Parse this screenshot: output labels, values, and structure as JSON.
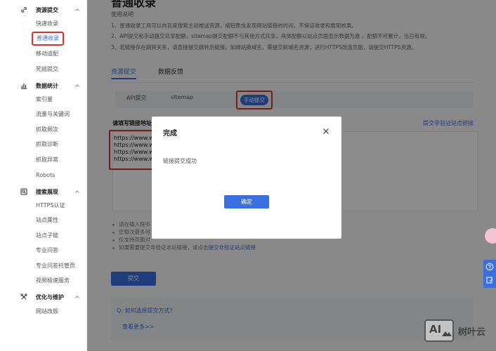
{
  "sidebar": {
    "sections": [
      {
        "title": "资源提交",
        "icon": "link-icon",
        "items": [
          "快速收录",
          "普通收录",
          "移动适配",
          "死链提交"
        ],
        "active": "普通收录"
      },
      {
        "title": "数据统计",
        "icon": "bar-chart-icon",
        "items": [
          "索引量",
          "流量与关键词",
          "抓取频次",
          "抓取诊断",
          "抓取异常",
          "Robots"
        ]
      },
      {
        "title": "搜索展现",
        "icon": "search-display-icon",
        "items": [
          "HTTPS认证",
          "站点属性",
          "站点子链",
          "专业问答",
          "专业问答托管页",
          "视频极速服务"
        ]
      },
      {
        "title": "优化与维护",
        "icon": "tools-icon",
        "items": [
          "网站改版"
        ]
      }
    ]
  },
  "main": {
    "page_title_partial": "普通收录",
    "usage_title": "使用说明",
    "usage_lines": [
      "1、普通收录工具可以向百度搜索主动推送资源，缩短爬虫发现网站链接的时间，不保证收录和展现效果。",
      "2、API提交和手动提交共享配额，sitemap提交配额不与其他方式共享，具体配额以站点页面显示数据为准 。配额不可累计，当日有效。",
      "3、若链接存在跳转关系，请直接提交跳转后链接。如网站换域名，需提交新域名资源；进行HTTPS改造页面，请提交HTTPS资源。"
    ],
    "tabs": [
      "资源提交",
      "数据反馈"
    ],
    "methods": [
      "API提交",
      "sitemap",
      "手动提交"
    ],
    "url_label": "请填写链接地址",
    "nonverified_link": "提交非验证站点链接",
    "url_lines": [
      "https://www.wjh",
      "https://www.wjh",
      "https://www.wjh",
      "https://www.wjh"
    ],
    "tips": [
      "请在输入框中",
      "您每次最多可",
      "仅支持页面对",
      "如果需要提交非验证本站链接，请点击"
    ],
    "tips_link": "提交非验证站点链接",
    "submit_label": "提交",
    "faq_question": "Q: 如何选择提交方式?",
    "faq_more": "查看更多>>"
  },
  "modal": {
    "title": "完成",
    "message": "链接提交成功",
    "ok_label": "确定"
  },
  "watermark": {
    "box_text": "AI",
    "text": "树叶云"
  },
  "colors": {
    "accent": "#3a6fe0",
    "highlight": "#d9342b",
    "overlay": "rgba(0,0,0,0.45)"
  }
}
